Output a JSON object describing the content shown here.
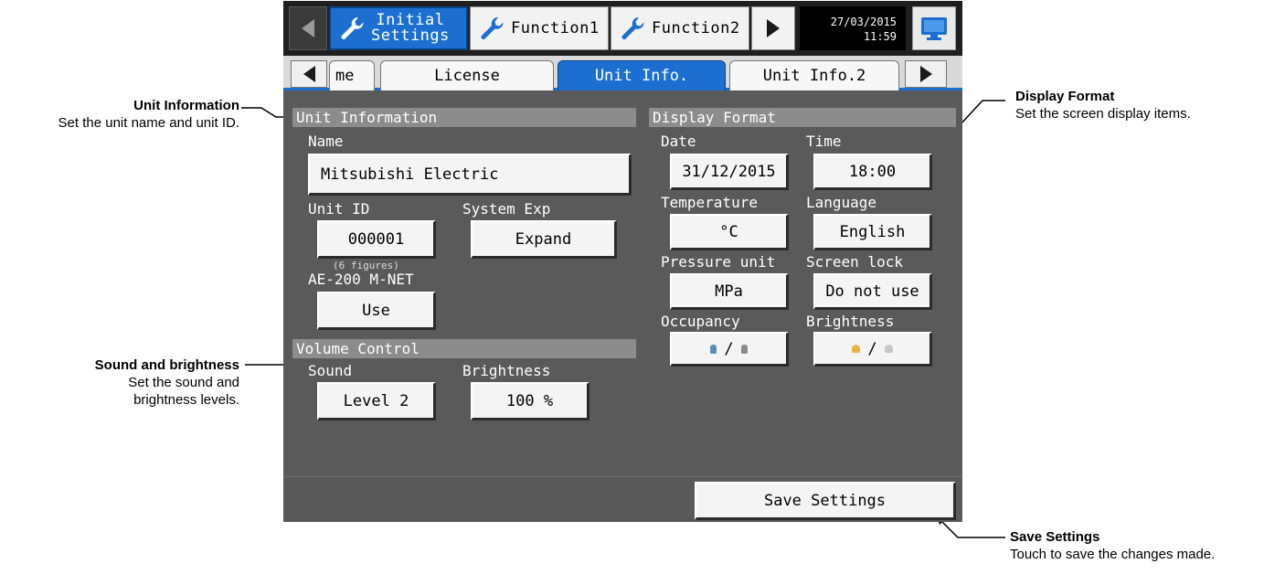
{
  "annotations": {
    "unit_info": {
      "title": "Unit Information",
      "desc": "Set the unit name and unit ID."
    },
    "sound": {
      "title": "Sound and brightness",
      "desc": "Set the sound and brightness levels."
    },
    "display": {
      "title": "Display Format",
      "desc": "Set the screen display items."
    },
    "save": {
      "title": "Save Settings",
      "desc": "Touch to save the changes made."
    }
  },
  "topbar": {
    "menu_tabs": [
      {
        "label_line1": "Initial",
        "label_line2": "Settings",
        "icon": "wrench-icon",
        "active": true
      },
      {
        "label": "Function1",
        "icon": "wrench-icon",
        "active": false
      },
      {
        "label": "Function2",
        "icon": "wrench-icon",
        "active": false
      }
    ],
    "date": "27/03/2015",
    "time": "11:59",
    "monitor_icon": "monitor-icon"
  },
  "subtabs": [
    {
      "label": "me",
      "active": false
    },
    {
      "label": "License",
      "active": false
    },
    {
      "label": "Unit Info.",
      "active": true
    },
    {
      "label": "Unit Info.2",
      "active": false
    }
  ],
  "unit_information": {
    "header": "Unit Information",
    "name_label": "Name",
    "name_value": "Mitsubishi Electric",
    "unit_id_label": "Unit ID",
    "unit_id_value": "000001",
    "unit_id_hint": "(6 figures)",
    "system_exp_label": "System Exp",
    "system_exp_value": "Expand",
    "mnet_label": "AE-200 M-NET",
    "mnet_value": "Use"
  },
  "volume_control": {
    "header": "Volume Control",
    "sound_label": "Sound",
    "sound_value": "Level 2",
    "brightness_label": "Brightness",
    "brightness_value": "100 %"
  },
  "display_format": {
    "header": "Display Format",
    "date_label": "Date",
    "date_value": "31/12/2015",
    "time_label": "Time",
    "time_value": "18:00",
    "temperature_label": "Temperature",
    "temperature_value": "°C",
    "language_label": "Language",
    "language_value": "English",
    "pressure_label": "Pressure unit",
    "pressure_value": "MPa",
    "screenlock_label": "Screen lock",
    "screenlock_value": "Do not use",
    "occupancy_label": "Occupancy",
    "occupancy_separator": "/",
    "brightness_label": "Brightness",
    "brightness_separator": "/"
  },
  "save_button": "Save Settings",
  "colors": {
    "active_tab": "#1c6fd0",
    "panel_bg": "#5a5a5a",
    "occupancy_icon": "#5b8fb8",
    "brightness_icon": "#e3b54a"
  }
}
